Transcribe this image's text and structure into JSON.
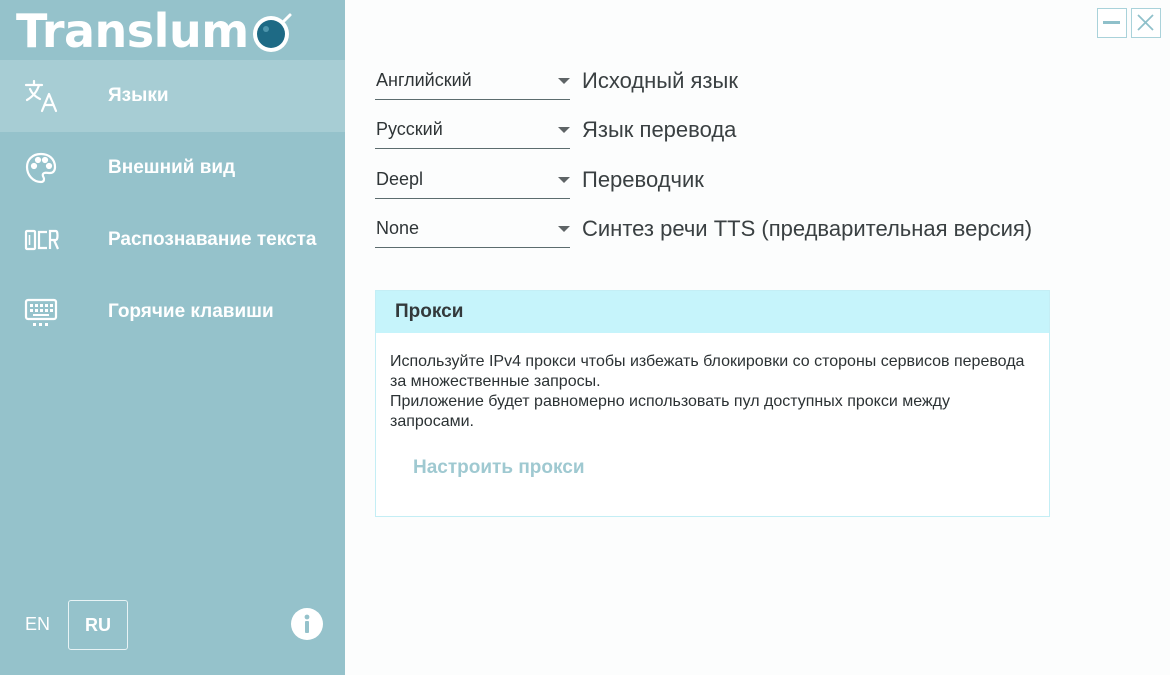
{
  "app": {
    "logo_text": "Translum",
    "brand_color": "#95c2cb",
    "accent_color": "#1e6a85"
  },
  "sidebar": {
    "items": [
      {
        "label": "Языки",
        "icon": "translate-icon",
        "active": true
      },
      {
        "label": "Внешний вид",
        "icon": "palette-icon",
        "active": false
      },
      {
        "label": "Распознавание текста",
        "icon": "ocr-icon",
        "active": false
      },
      {
        "label": "Горячие клавиши",
        "icon": "keyboard-icon",
        "active": false
      }
    ],
    "languages": {
      "en": "EN",
      "ru": "RU",
      "selected": "RU"
    },
    "info_icon": "info-icon"
  },
  "window_controls": {
    "minimize_icon": "minimize-icon",
    "close_icon": "close-icon"
  },
  "settings": {
    "source_language": {
      "value": "Английский",
      "label": "Исходный язык"
    },
    "target_language": {
      "value": "Русский",
      "label": "Язык перевода"
    },
    "translator": {
      "value": "Deepl",
      "label": "Переводчик"
    },
    "tts": {
      "value": "None",
      "label": "Синтез речи TTS (предварительная версия)"
    }
  },
  "proxy": {
    "title": "Прокси",
    "description_line1": "Используйте IPv4 прокси чтобы избежать блокировки со стороны сервисов перевода за множественные запросы.",
    "description_line2": "Приложение будет равномерно использовать пул доступных прокси между запросами.",
    "button_label": "Настроить прокси"
  }
}
